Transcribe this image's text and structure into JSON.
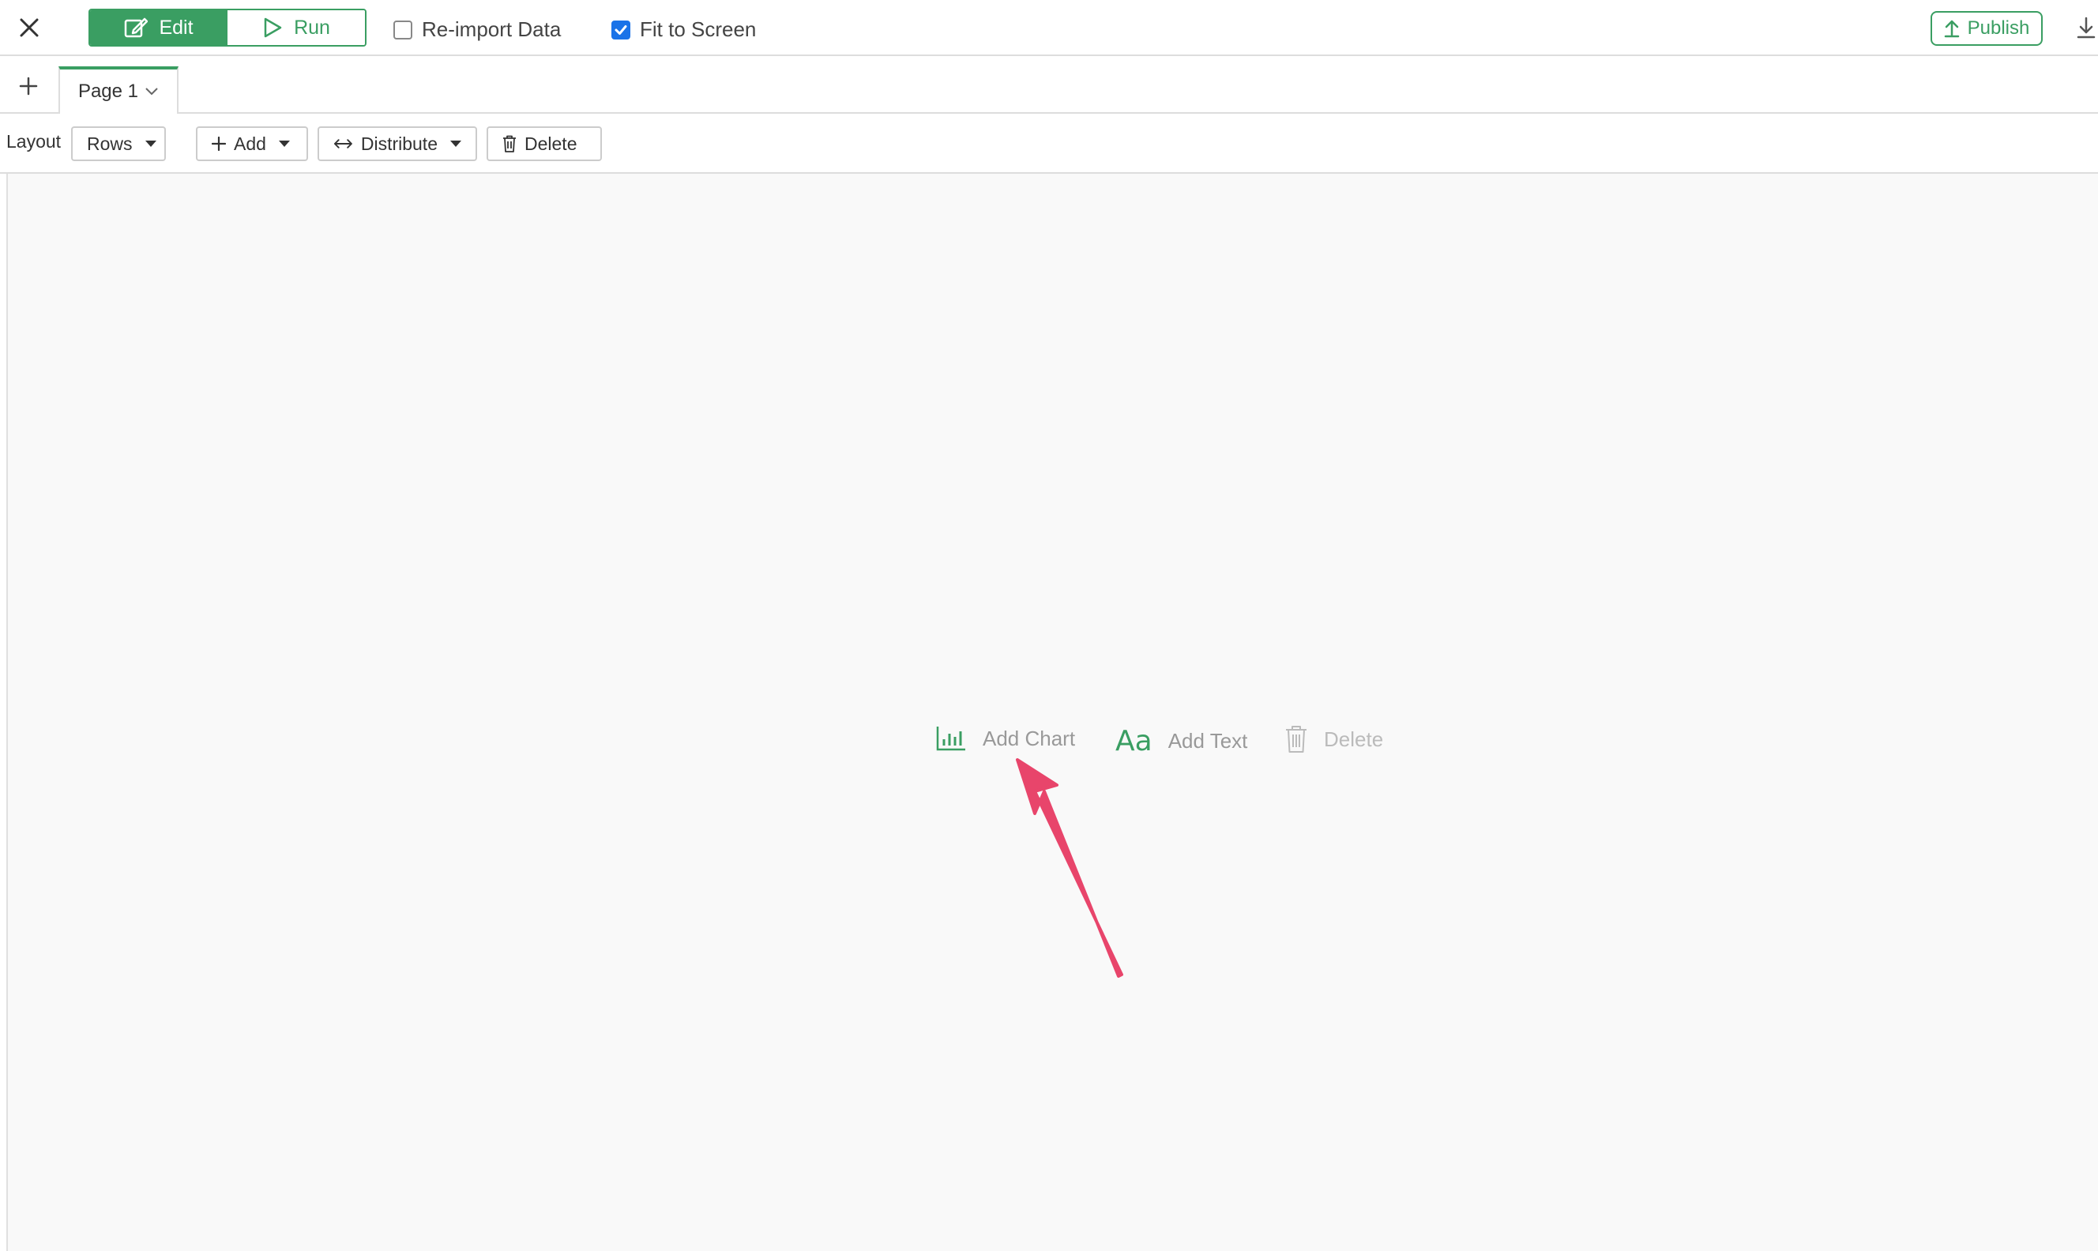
{
  "header": {
    "close_icon": "close-icon",
    "mode_edit_label": "Edit",
    "mode_run_label": "Run",
    "reimport_label": "Re-import Data",
    "reimport_checked": false,
    "fit_label": "Fit to Screen",
    "fit_checked": true,
    "publish_label": "Publish",
    "download_icon": "download-icon"
  },
  "tabs": {
    "add_icon": "plus-icon",
    "items": [
      {
        "label": "Page 1",
        "active": true
      }
    ]
  },
  "toolbar": {
    "layout_label": "Layout",
    "layout_value": "Rows",
    "add_label": "Add",
    "distribute_label": "Distribute",
    "delete_label": "Delete"
  },
  "canvas": {
    "add_chart_label": "Add Chart",
    "add_text_label": "Add Text",
    "add_text_icon_text": "Aa",
    "delete_label": "Delete"
  },
  "colors": {
    "accent": "#3a9e62",
    "checkbox_blue": "#1a73e8",
    "annotation_arrow": "#e8456b"
  }
}
